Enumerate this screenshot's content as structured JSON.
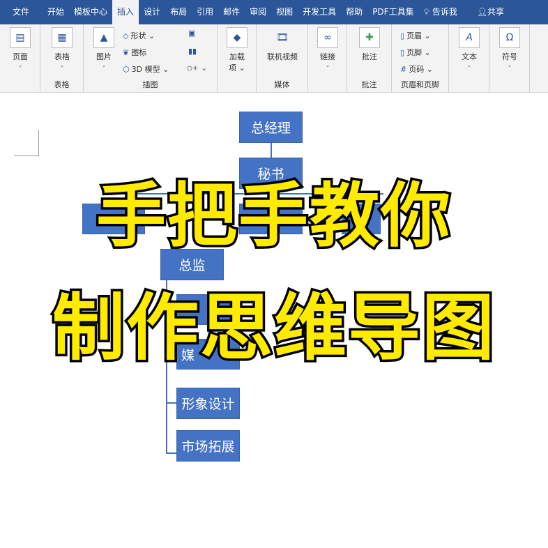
{
  "tabs": [
    "文件",
    "开始",
    "模板中心",
    "插入",
    "设计",
    "布局",
    "引用",
    "邮件",
    "审阅",
    "视图",
    "开发工具",
    "帮助",
    "PDF工具集",
    "告诉我",
    "共享"
  ],
  "active_tab": "插入",
  "ribbon": {
    "page": {
      "label": "页面",
      "icon": "page-icon"
    },
    "table": {
      "label": "表格",
      "group": "表格"
    },
    "picture": {
      "label": "图片"
    },
    "shapes": "形状",
    "icons": "图标",
    "model3d": "3D 模型",
    "illus_group": "插图",
    "addins": {
      "label1": "加载",
      "label2": "项"
    },
    "video": {
      "label": "联机视频",
      "group": "媒体"
    },
    "link": {
      "label": "链接"
    },
    "comment": {
      "label": "批注",
      "group": "批注"
    },
    "header": "页眉",
    "footer": "页脚",
    "pagenum": "页码",
    "hf_group": "页眉和页脚",
    "text": {
      "label": "文本"
    },
    "symbol": {
      "label": "符号"
    }
  },
  "chart": {
    "ceo": "总经理",
    "secretary": "秘书",
    "director": "总监",
    "child_partial": "媒",
    "image_design": "形象设计",
    "market": "市场拓展"
  },
  "overlay": {
    "line1": "手把手教你",
    "line2": "制作思维导图",
    "color": "#ffeb00"
  },
  "colors": {
    "ribbon_blue": "#2b579a",
    "box_blue": "#4472c4"
  }
}
